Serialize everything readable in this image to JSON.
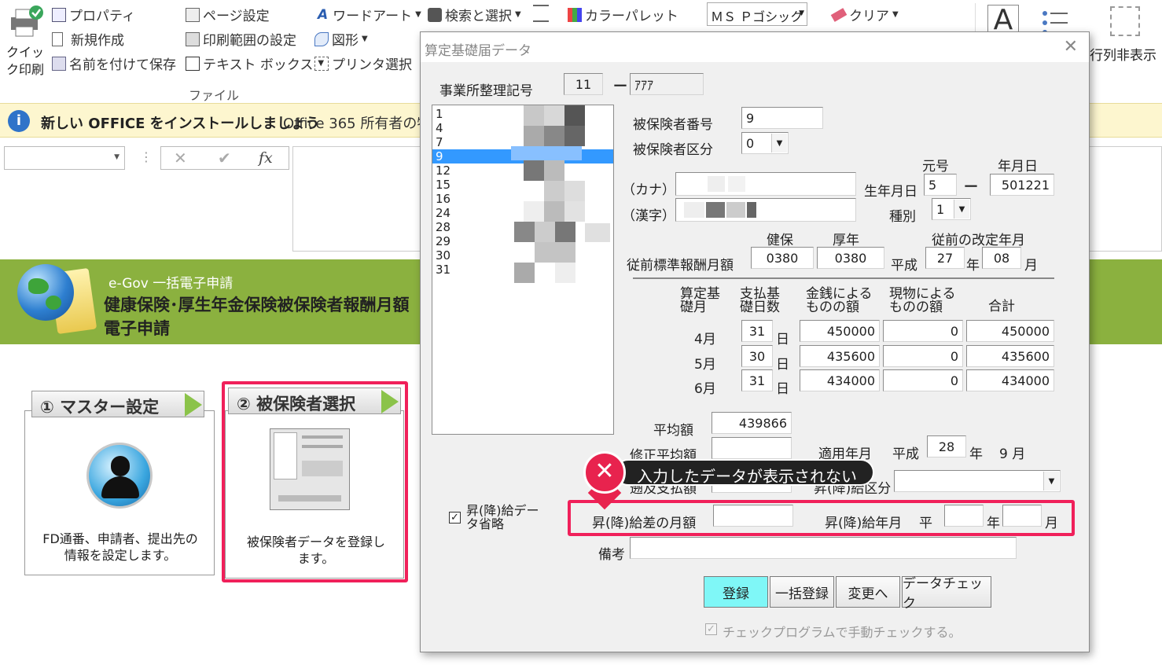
{
  "ribbon": {
    "quick_print": "クイック印刷",
    "properties": "プロパティ",
    "new_doc": "新規作成",
    "save_as": "名前を付けて保存",
    "page_setup": "ページ設定",
    "print_range": "印刷範囲の設定",
    "text_box": "テキスト ボックス",
    "word_art": "ワードアート",
    "shapes": "図形",
    "printer_select": "プリンタ選択",
    "search_select": "検索と選択",
    "color_palette": "カラーパレット",
    "font_name": "ＭＳ Ｐゴシック",
    "clear": "クリア",
    "hide_rows_cols": "行列非表示",
    "group_file": "ファイル"
  },
  "infobar": {
    "title": "新しい OFFICE をインストールしましょう",
    "message": "Office 365 所有者の特"
  },
  "formula": {
    "fx": "fx"
  },
  "banner": {
    "subtitle": "e-Gov 一括電子申請",
    "title_line1": "健康保険･厚生年金保険被保険者報酬月額",
    "title_line2": "電子申請"
  },
  "steps": [
    {
      "label": "① マスター設定",
      "desc": "FD通番、申請者、提出先の情報を設定します。"
    },
    {
      "label": "② 被保険者選択",
      "desc": "被保険者データを登録します。"
    }
  ],
  "dialog": {
    "title": "算定基礎届データ",
    "office_label": "事業所整理記号",
    "office_code1": "11",
    "office_code2": "ｱｱｱ",
    "list_items": [
      "1",
      "4",
      "7",
      "9",
      "12",
      "15",
      "16",
      "24",
      "28",
      "29",
      "30",
      "31"
    ],
    "selected_index": 3,
    "insured_no_label": "被保険者番号",
    "insured_no": "9",
    "insured_type_label": "被保険者区分",
    "insured_type": "0",
    "kana_label": "（カナ）",
    "kanji_label": "（漢字）",
    "era_label": "元号",
    "ymd_label": "年月日",
    "birth_label": "生年月日",
    "birth_era": "5",
    "birth_date": "501221",
    "kind_label": "種別",
    "kind": "1",
    "kenpo_label": "健保",
    "kosei_label": "厚年",
    "prev_rev_label": "従前の改定年月",
    "prev_std_label": "従前標準報酬月額",
    "prev_kenpo": "0380",
    "prev_kosei": "0380",
    "heisei": "平成",
    "prev_year": "27",
    "year_char": "年",
    "prev_month": "08",
    "month_char": "月",
    "col_base_month": "算定基礎月",
    "col_pay_days": "支払基礎日数",
    "col_cash": "金銭によるものの額",
    "col_goods": "現物によるものの額",
    "col_total": "合計",
    "day_char": "日",
    "rows": [
      {
        "month": "4月",
        "days": "31",
        "cash": "450000",
        "goods": "0",
        "total": "450000"
      },
      {
        "month": "5月",
        "days": "30",
        "cash": "435600",
        "goods": "0",
        "total": "435600"
      },
      {
        "month": "6月",
        "days": "31",
        "cash": "434000",
        "goods": "0",
        "total": "434000"
      }
    ],
    "avg_label": "平均額",
    "avg_value": "439866",
    "mod_avg_label": "修正平均額",
    "apply_label": "適用年月",
    "apply_era": "平成",
    "apply_year": "28",
    "apply_month_text": "9 月",
    "retro_label": "遡及支払額",
    "raise_type_label": "昇(降)給区分",
    "raise_omit_label": "昇(降)給データ省略",
    "raise_diff_label": "昇(降)給差の月額",
    "raise_ym_label": "昇(降)給年月",
    "raise_era": "平",
    "remarks_label": "備考",
    "btn_register": "登録",
    "btn_bulk": "一括登録",
    "btn_change": "変更へ",
    "btn_check": "データチェック",
    "manual_check": "チェックプログラムで手動チェックする。"
  },
  "callout": {
    "text": "入力したデータが表示されない"
  },
  "colors": {
    "accent_red": "#f0205a",
    "banner_green": "#8bb13f",
    "selection": "#3399ff",
    "register_btn": "#7ff7f7"
  }
}
